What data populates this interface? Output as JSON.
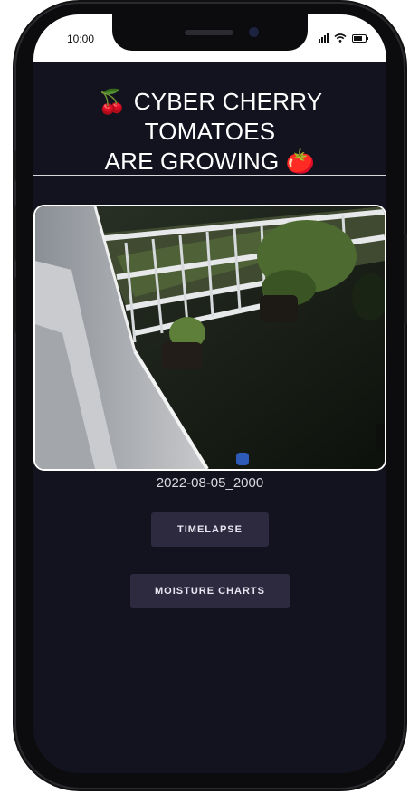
{
  "status_bar": {
    "time": "10:00",
    "icons": [
      "signal-icon",
      "wifi-icon",
      "battery-icon"
    ]
  },
  "header": {
    "title_line1": "🍒 CYBER CHERRY TOMATOES",
    "title_line2": "ARE GROWING 🍅"
  },
  "photo": {
    "description_icon": "camera-snapshot",
    "caption": "2022-08-05_2000"
  },
  "buttons": {
    "timelapse_label": "TIMELAPSE",
    "moisture_label": "MOISTURE CHARTS"
  },
  "colors": {
    "background": "#13131f",
    "button": "#2d2a40",
    "text": "#ffffff"
  }
}
